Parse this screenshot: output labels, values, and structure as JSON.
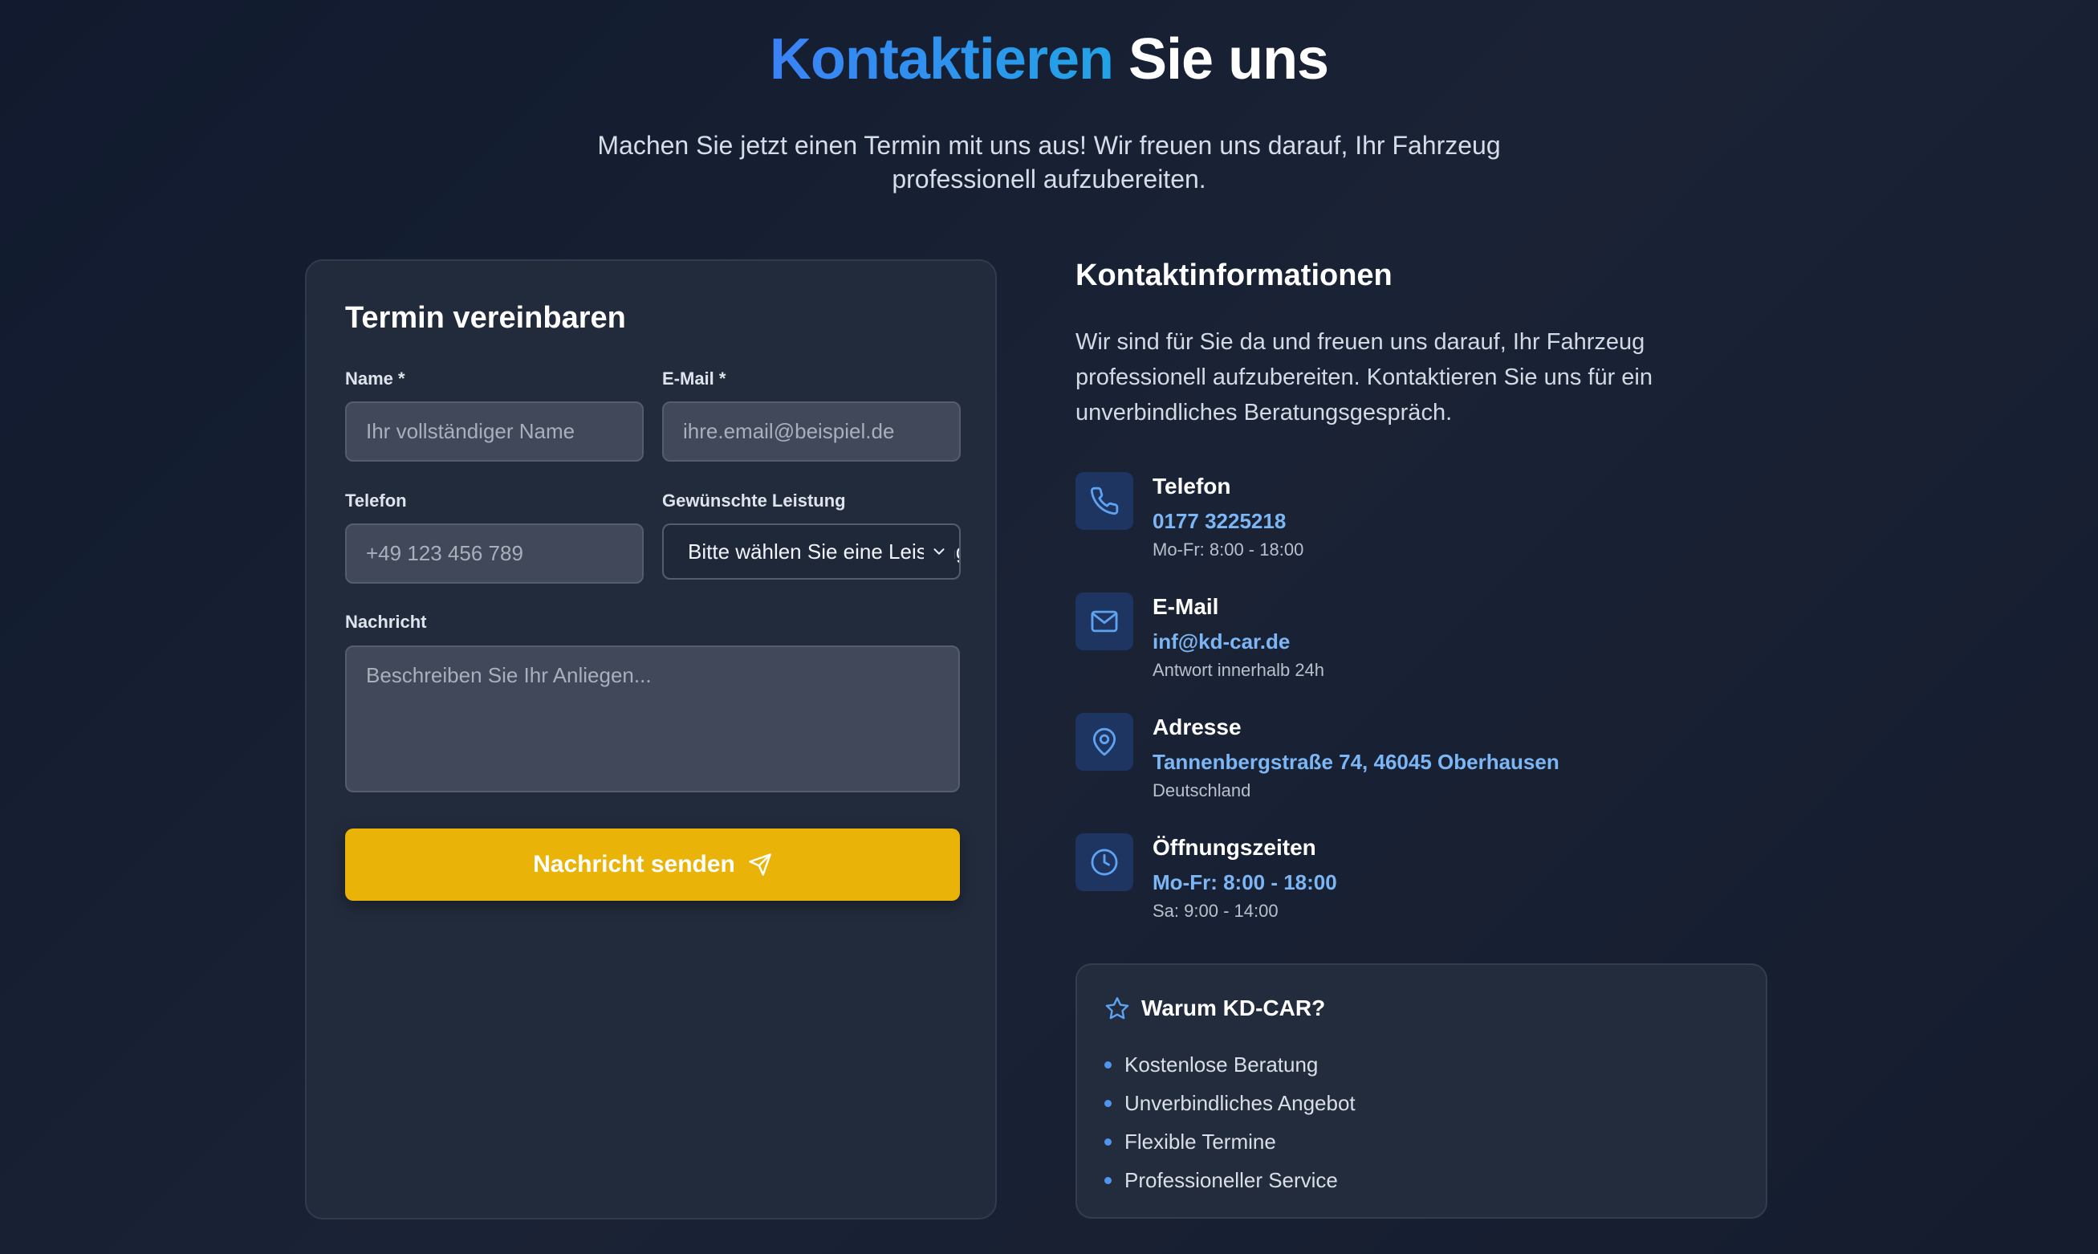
{
  "hero": {
    "title_accent": "Kontaktieren",
    "title_rest": "Sie uns",
    "subtitle": "Machen Sie jetzt einen Termin mit uns aus! Wir freuen uns darauf, Ihr Fahrzeug professionell aufzubereiten."
  },
  "form": {
    "title": "Termin vereinbaren",
    "name_label": "Name *",
    "name_placeholder": "Ihr vollständiger Name",
    "email_label": "E-Mail *",
    "email_placeholder": "ihre.email@beispiel.de",
    "phone_label": "Telefon",
    "phone_placeholder": "+49 123 456 789",
    "service_label": "Gewünschte Leistung",
    "service_selected": "Bitte wählen Sie eine Leistung",
    "message_label": "Nachricht",
    "message_placeholder": "Beschreiben Sie Ihr Anliegen...",
    "submit_label": "Nachricht senden"
  },
  "contact": {
    "title": "Kontaktinformationen",
    "intro": "Wir sind für Sie da und freuen uns darauf, Ihr Fahrzeug professionell aufzubereiten. Kontaktieren Sie uns für ein unverbindliches Beratungsgespräch.",
    "items": [
      {
        "icon": "phone-icon",
        "title": "Telefon",
        "value": "0177 3225218",
        "sub": "Mo-Fr: 8:00 - 18:00"
      },
      {
        "icon": "mail-icon",
        "title": "E-Mail",
        "value": "inf@kd-car.de",
        "sub": "Antwort innerhalb 24h"
      },
      {
        "icon": "map-pin-icon",
        "title": "Adresse",
        "value": "Tannenbergstraße 74, 46045 Oberhausen",
        "sub": "Deutschland"
      },
      {
        "icon": "clock-icon",
        "title": "Öffnungszeiten",
        "value": "Mo-Fr: 8:00 - 18:00",
        "sub": "Sa: 9:00 - 14:00"
      }
    ]
  },
  "why": {
    "title": "Warum KD-CAR?",
    "items": [
      "Kostenlose Beratung",
      "Unverbindliches Angebot",
      "Flexible Termine",
      "Professioneller Service"
    ]
  },
  "colors": {
    "accent_blue": "#3b82f6",
    "link_blue": "#7cb6f5",
    "button_yellow": "#eab308",
    "background": "#151d2f"
  }
}
